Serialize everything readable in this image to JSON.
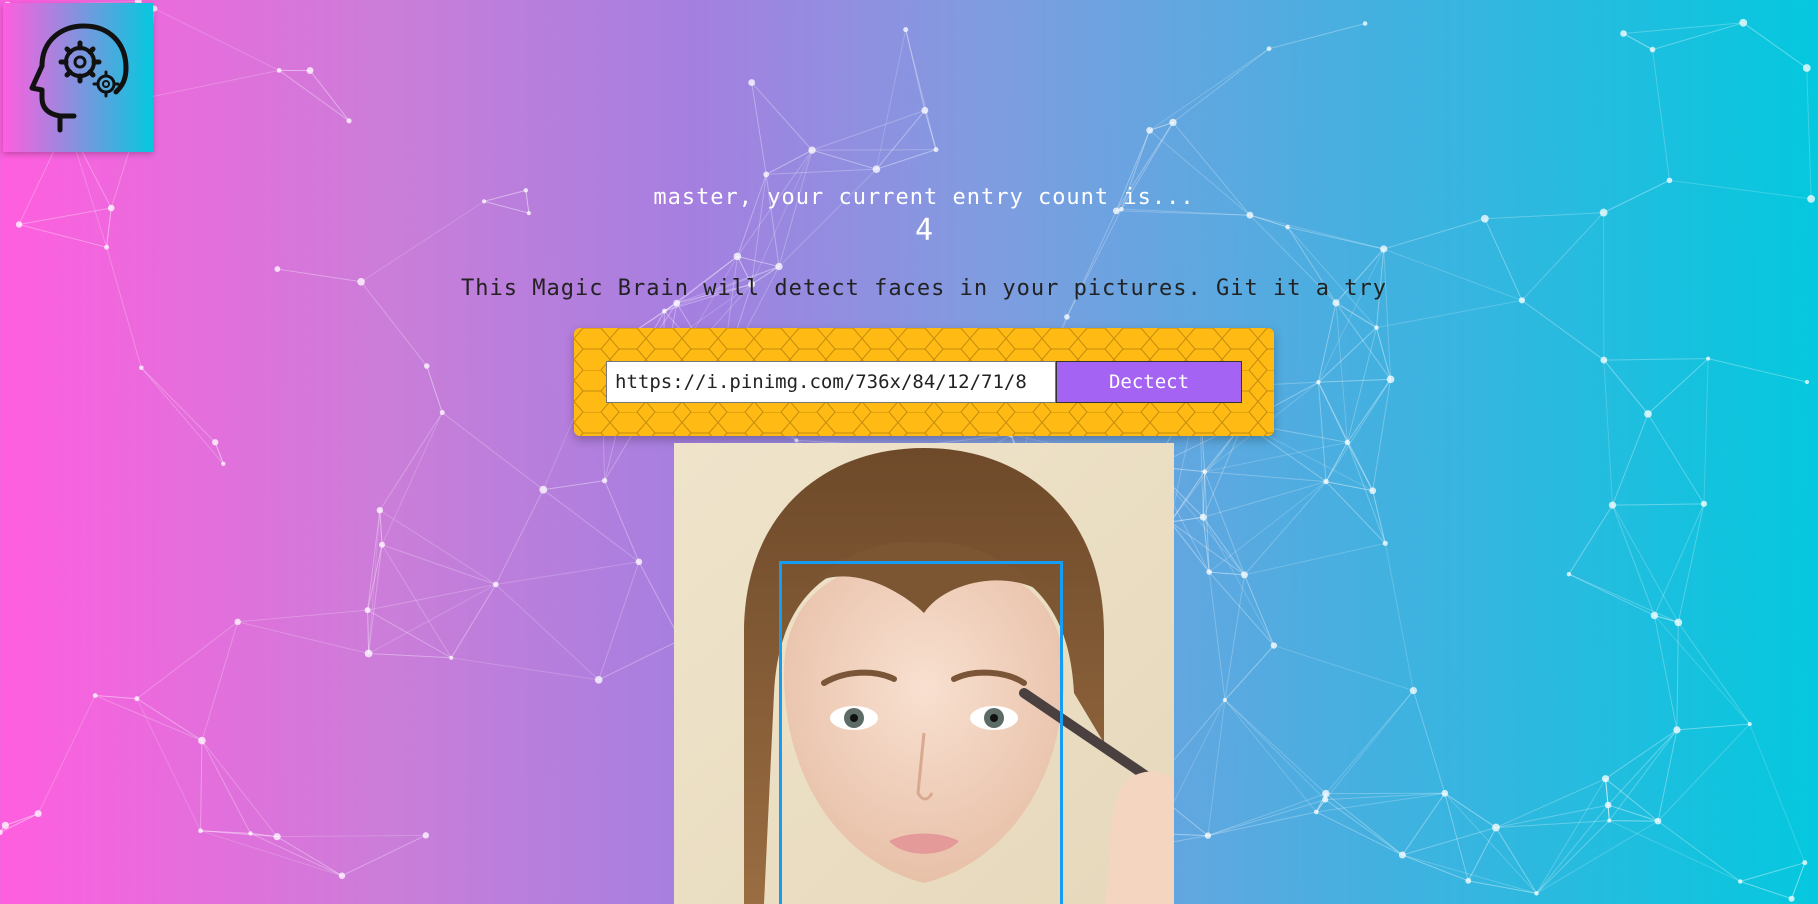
{
  "logo": {
    "icon": "brain-gear-head-icon"
  },
  "entry": {
    "message": "master, your current entry count is...",
    "count": "4"
  },
  "tagline": "This Magic Brain will detect faces in your pictures. Git it a try",
  "form": {
    "input_value": "https://i.pinimg.com/736x/84/12/71/8",
    "detect_label": "Dectect"
  },
  "colors": {
    "background_start": "#ff5edf",
    "background_end": "#04c8de",
    "panel": "#ffbb13",
    "button": "#a463f2",
    "face_box": "#149df2"
  }
}
